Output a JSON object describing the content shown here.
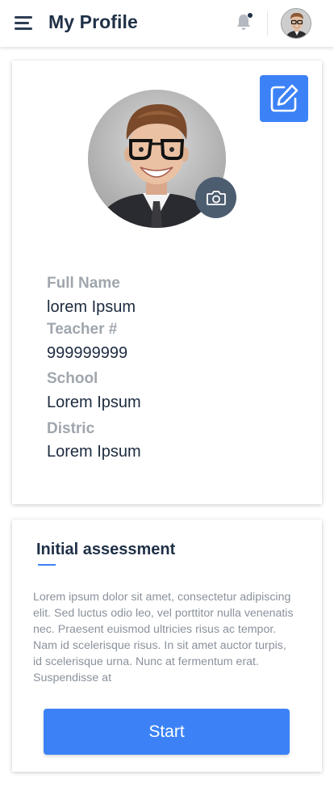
{
  "header": {
    "title": "My Profile",
    "menu_icon": "hamburger-menu-icon",
    "notification_icon": "bell-icon",
    "has_unread_notification": true
  },
  "profile": {
    "edit_icon": "edit-pencil-icon",
    "camera_icon": "camera-icon",
    "fields": [
      {
        "label": "Full Name",
        "value": "lorem Ipsum"
      },
      {
        "label": "Teacher #",
        "value": "999999999"
      },
      {
        "label": "School",
        "value": "Lorem Ipsum"
      },
      {
        "label": "Distric",
        "value": "Lorem Ipsum"
      }
    ]
  },
  "assessment": {
    "title": "Initial assessment",
    "body": "Lorem ipsum dolor sit amet, consectetur adipiscing elit. Sed luctus odio leo, vel porttitor nulla venenatis nec. Praesent euismod ultricies risus ac tempor. Nam id scelerisque risus. In sit amet auctor turpis, id scelerisque urna. Nunc at fermentum erat. Suspendisse at",
    "start_label": "Start"
  },
  "colors": {
    "accent": "#3c82f6",
    "title_text": "#1f3047",
    "label_text": "#a0a6ae",
    "body_text": "#8a929c",
    "camera_button": "#4d5d70"
  }
}
